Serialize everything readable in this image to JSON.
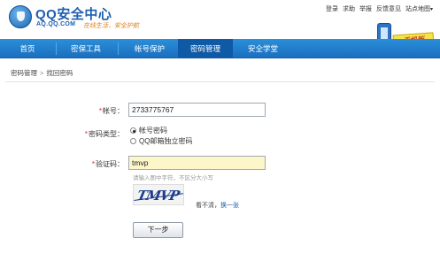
{
  "header": {
    "logo_title": "QQ安全中心",
    "logo_url": "AQ.QQ.COM",
    "logo_slogan": "在线生活，安全护航",
    "top_links": [
      "登录",
      "求助",
      "举报",
      "反馈意见",
      "站点地图"
    ]
  },
  "phone_badge": {
    "label": "手机版"
  },
  "nav": {
    "items": [
      {
        "label": "首页"
      },
      {
        "label": "密保工具"
      },
      {
        "label": "帐号保护"
      },
      {
        "label": "密码管理"
      },
      {
        "label": "安全学堂"
      }
    ],
    "active_index": 3
  },
  "breadcrumb": {
    "parent": "密码管理",
    "separator": ">",
    "current": "找回密码"
  },
  "form": {
    "account_label": "帐号：",
    "account_value": "2733775767",
    "pwd_type_label": "密码类型：",
    "pwd_type_options": [
      "帐号密码",
      "QQ邮箱独立密码"
    ],
    "pwd_type_selected": 0,
    "captcha_label": "验证码：",
    "captcha_value": "tmvp",
    "captcha_hint": "请输入图中字符，不区分大小写",
    "captcha_image_text": "TMVP",
    "refresh_prefix": "看不清，",
    "refresh_link": "换一张",
    "submit_label": "下一步"
  },
  "colors": {
    "nav_bg": "#1a6fbf",
    "nav_active": "#0f5aa6",
    "brand_blue": "#1d5fae",
    "required_mark": "#dd2222",
    "captcha_field_bg": "#fdf6c8"
  }
}
